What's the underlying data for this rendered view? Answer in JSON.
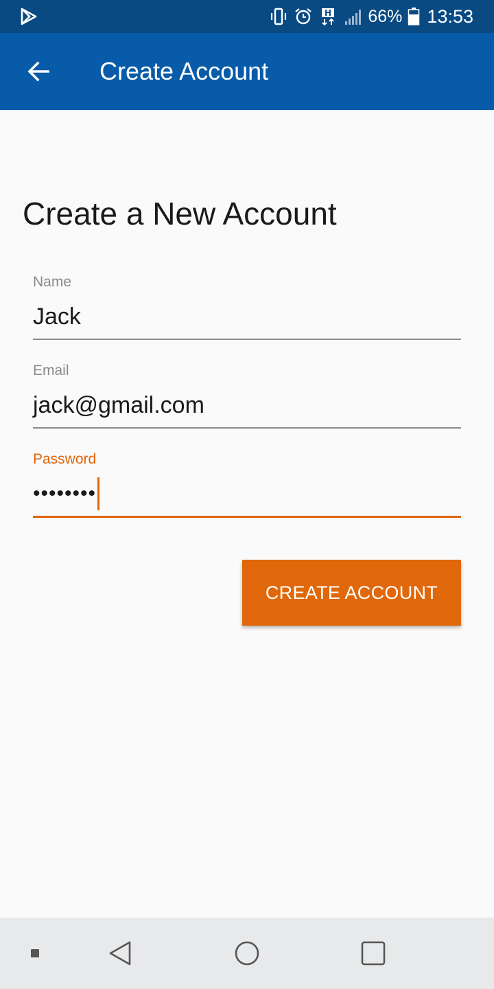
{
  "status_bar": {
    "icons": [
      "play-store-icon",
      "vibrate-icon",
      "alarm-icon",
      "hplus-data-icon",
      "signal-icon",
      "battery-icon"
    ],
    "battery_percent": "66%",
    "time": "13:53"
  },
  "app_bar": {
    "title": "Create Account",
    "back_icon": "arrow-back-icon",
    "background": "#075ba8"
  },
  "form": {
    "heading": "Create a New Account",
    "fields": [
      {
        "label": "Name",
        "value": "Jack",
        "focused": false
      },
      {
        "label": "Email",
        "value": "jack@gmail.com",
        "focused": false
      },
      {
        "label": "Password",
        "value": "••••••••",
        "focused": true
      }
    ],
    "submit_label": "CREATE ACCOUNT",
    "accent_color": "#e0680a"
  },
  "nav_bar": {
    "icons": [
      "menu-dot-icon",
      "back-triangle-icon",
      "home-circle-icon",
      "recents-square-icon"
    ]
  }
}
